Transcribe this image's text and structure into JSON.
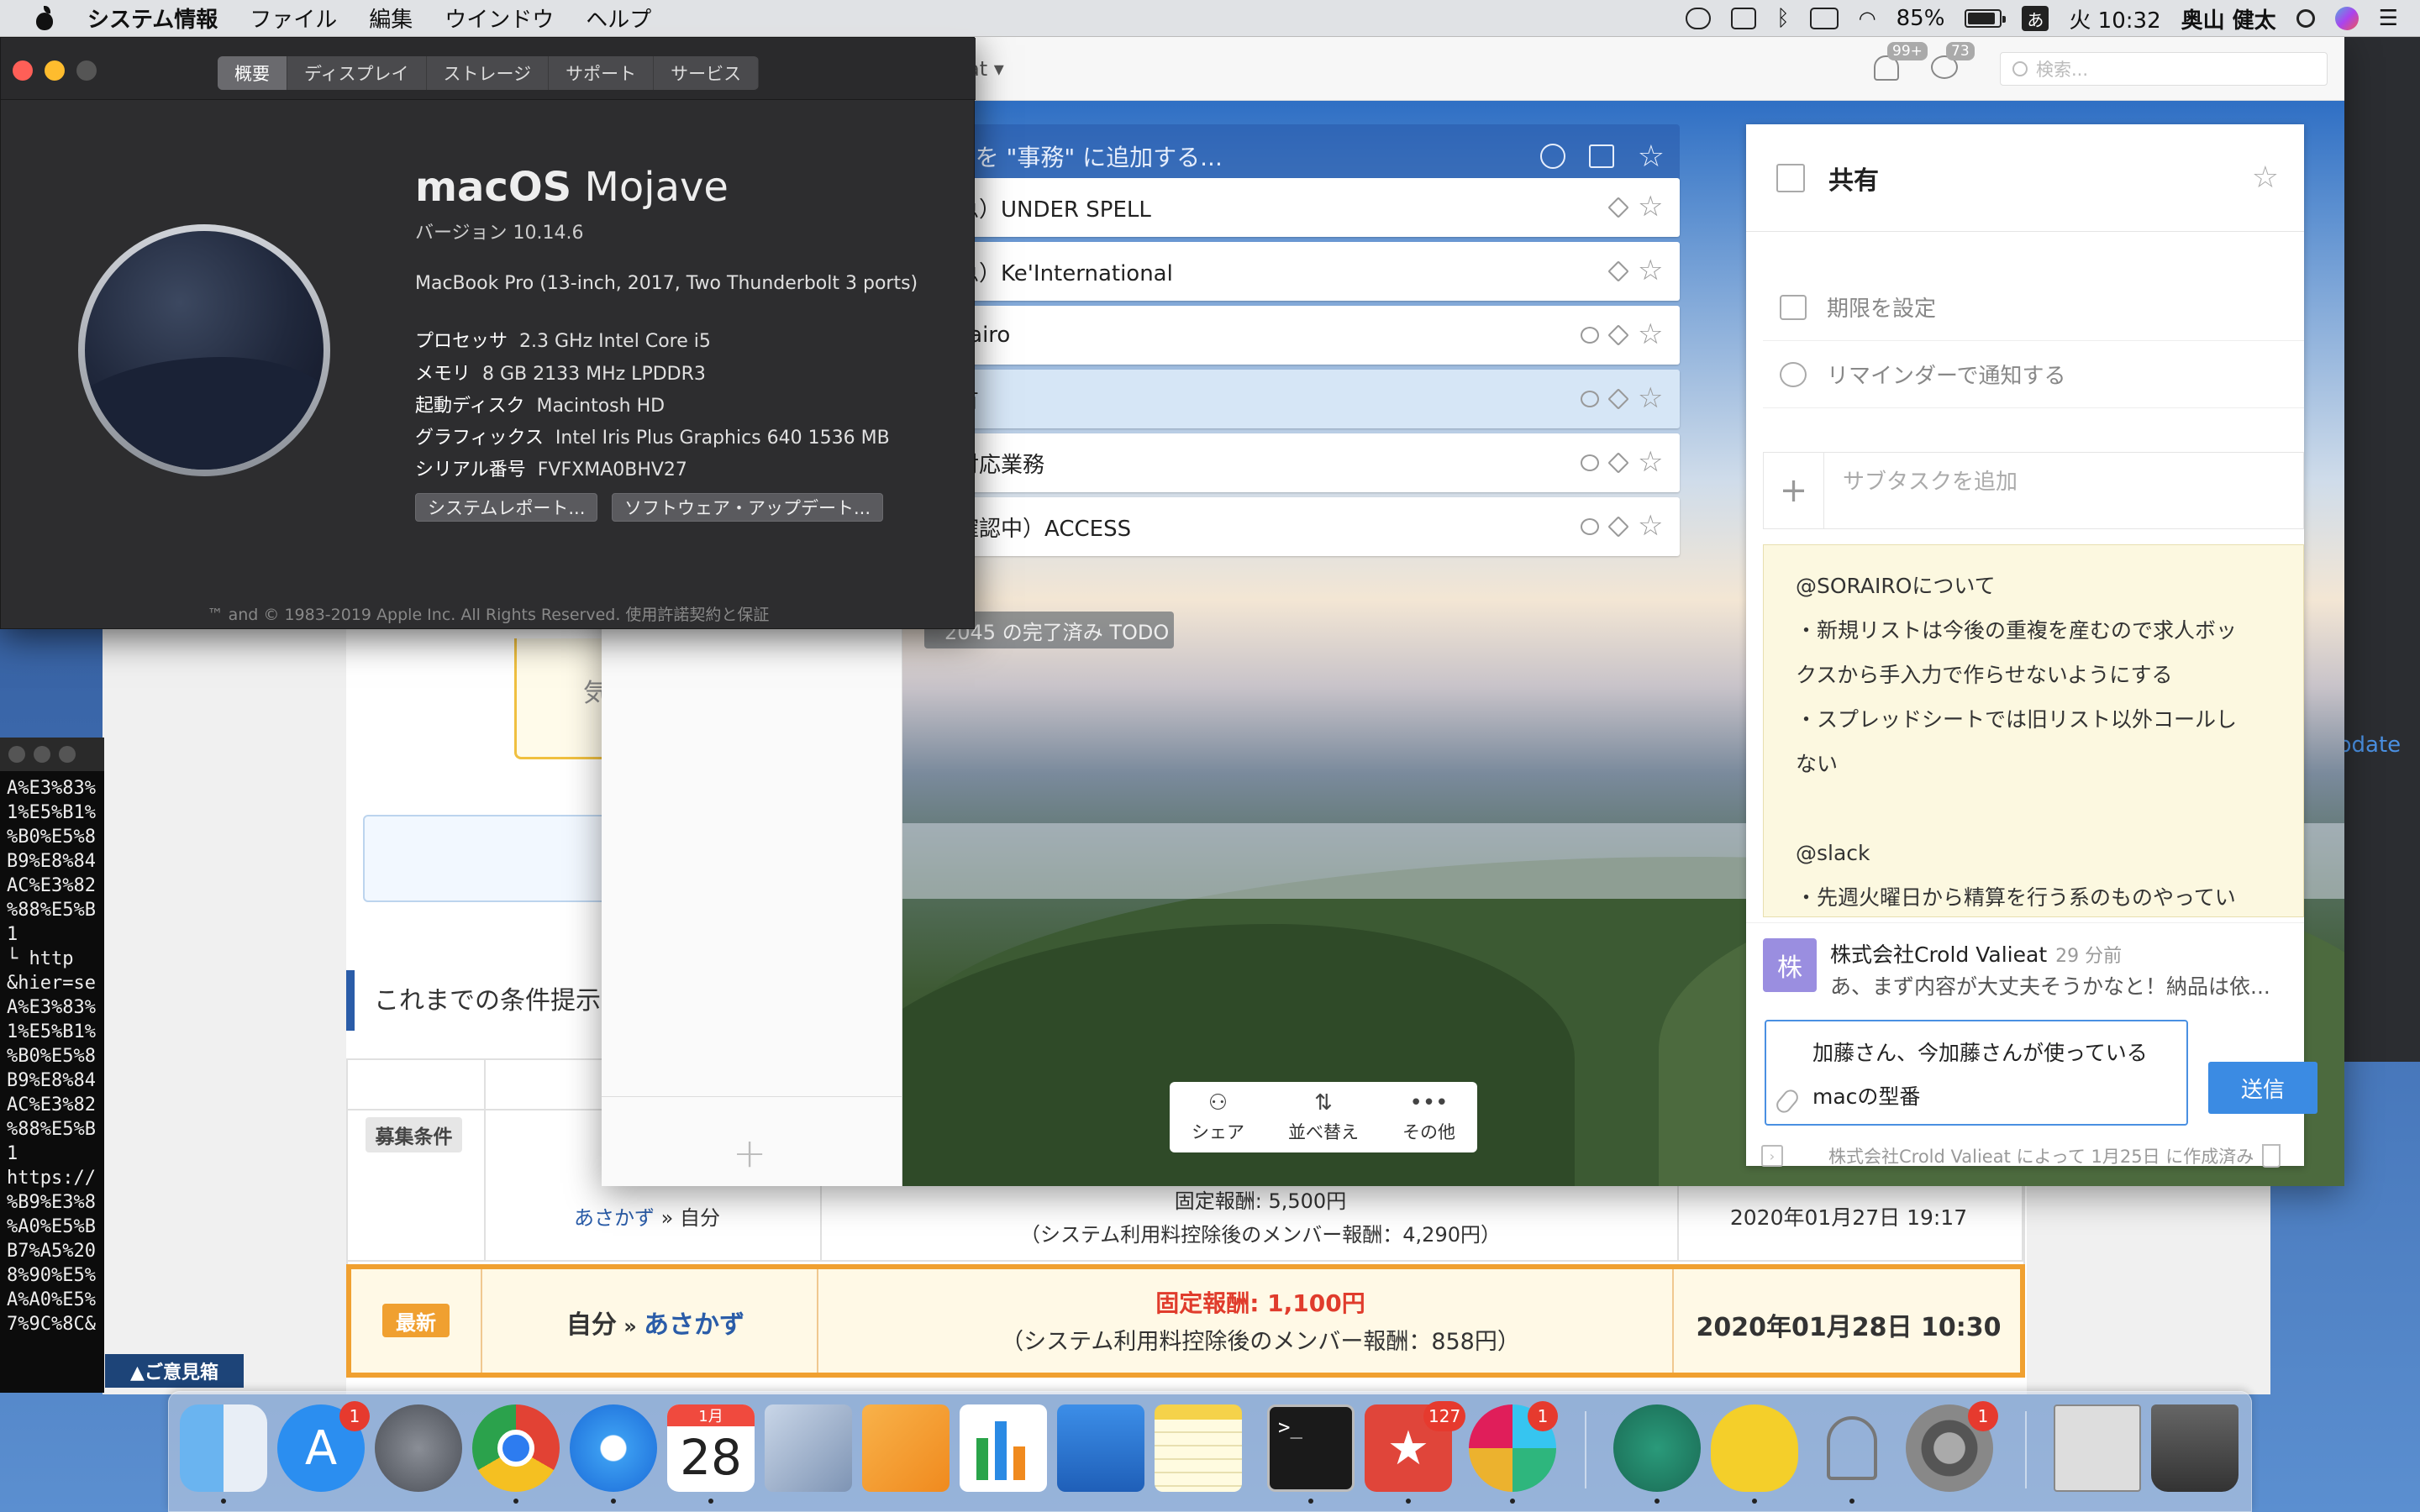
{
  "menubar": {
    "app": "システム情報",
    "items": [
      "ファイル",
      "編集",
      "ウインドウ",
      "ヘルプ"
    ],
    "battery": "85%",
    "ime": "あ",
    "clock": "火 10:32",
    "user": "奥山 健太"
  },
  "about": {
    "tabs": [
      "概要",
      "ディスプレイ",
      "ストレージ",
      "サポート",
      "サービス"
    ],
    "os_name_bold": "macOS",
    "os_name_rest": " Mojave",
    "version": "バージョン 10.14.6",
    "model": "MacBook Pro (13-inch, 2017, Two Thunderbolt 3 ports)",
    "specs": [
      {
        "label": "プロセッサ",
        "value": "2.3 GHz Intel Core i5"
      },
      {
        "label": "メモリ",
        "value": "8 GB 2133 MHz LPDDR3"
      },
      {
        "label": "起動ディスク",
        "value": "Macintosh HD"
      },
      {
        "label": "グラフィックス",
        "value": "Intel Iris Plus Graphics 640 1536 MB"
      },
      {
        "label": "シリアル番号",
        "value": "FVFXMA0BHV27"
      }
    ],
    "btn_report": "システムレポート...",
    "btn_update": "ソフトウェア・アップデート...",
    "copyright": "™ and © 1983-2019 Apple Inc. All Rights Reserved. 使用許諾契約と保証"
  },
  "wunderlist": {
    "title_fragment": "at ▾",
    "notif_badge": "99+",
    "chat_badge": "73",
    "search_placeholder": "検索...",
    "add_placeholder": "Do を \"事務\" に追加する...",
    "tasks": [
      {
        "title": "（急）UNDER SPELL"
      },
      {
        "title": "（急）Ke'International"
      },
      {
        "title": "sorairo"
      },
      {
        "title": "共有"
      },
      {
        "title": "未対応業務"
      },
      {
        "title": "（確認中）ACCESS"
      }
    ],
    "completed": "2045 の完了済み TODO",
    "toolbar": {
      "share": "シェア",
      "sort": "並べ替え",
      "more": "その他"
    },
    "detail": {
      "title": "共有",
      "due": "期限を設定",
      "reminder": "リマインダーで通知する",
      "subtask_placeholder": "サブタスクを追加",
      "note_lines": [
        "@SORAIROについて",
        "・新規リストは今後の重複を産むので求人ボッ",
        "クスから手入力で作らせないようにする",
        "・スプレッドシートでは旧リスト以外コールし",
        "ない",
        "",
        "@slack",
        "・先週火曜日から精算を行う系のものやってい"
      ],
      "comment_author": "株式会社Crold Valieat",
      "comment_time": "29 分前",
      "comment_text": "あ、まず内容が大丈夫そうかなと！納品は依...",
      "avatar": "株",
      "message_line1": "加藤さん、今加藤さんが使っている",
      "message_line2": "macの型番",
      "send": "送信",
      "footer": "株式会社Crold Valieat によって 1月25日 に作成済み"
    }
  },
  "browser": {
    "section_title": "これまでの条件提示",
    "badge_cond": "募集条件",
    "row1": {
      "who": "あさかず",
      "sep": " » ",
      "to": "自分",
      "fee": "固定報酬: 5,500円",
      "fee_sub": "（システム利用料控除後のメンバー報酬：4,290円）",
      "date": "2020年01月27日 19:17"
    },
    "row2": {
      "badge": "最新",
      "who": "自分",
      "sep": " » ",
      "to": "あさかず",
      "fee": "固定報酬: 1,100円",
      "fee_sub": "（システム利用料控除後のメンバー報酬：858円）",
      "date": "2020年01月28日 10:30"
    },
    "feedback": "▲ご意見箱",
    "partial_char": "気"
  },
  "terminal": {
    "lines": [
      "A%E3%83%",
      "1%E5%B1%",
      "%B0%E5%8",
      "B9%E8%84",
      "AC%E3%82",
      "%88%E5%B",
      "1",
      "└ http",
      "&hier=se",
      "A%E3%83%",
      "1%E5%B1%",
      "%B0%E5%8",
      "B9%E8%84",
      "AC%E3%82",
      "%88%E5%B",
      "1",
      "https://",
      "%B9%E3%8",
      "%A0%E5%B",
      "B7%A5%20",
      "8%90%E5%",
      "A%A0%E5%",
      "7%9C%8C&"
    ]
  },
  "dark_window": {
    "update": "pdate"
  },
  "dock": {
    "calendar_month": "1月",
    "calendar_day": "28",
    "badges": {
      "appstore": "1",
      "wunderlist": "127",
      "slack": "1",
      "prefs": "1"
    },
    "terminal_prompt": ">_"
  },
  "colors": {
    "accent": "#3b8be3",
    "latest": "#f0a030",
    "fee_red": "#e03c2c",
    "link": "#2a5ca8"
  }
}
